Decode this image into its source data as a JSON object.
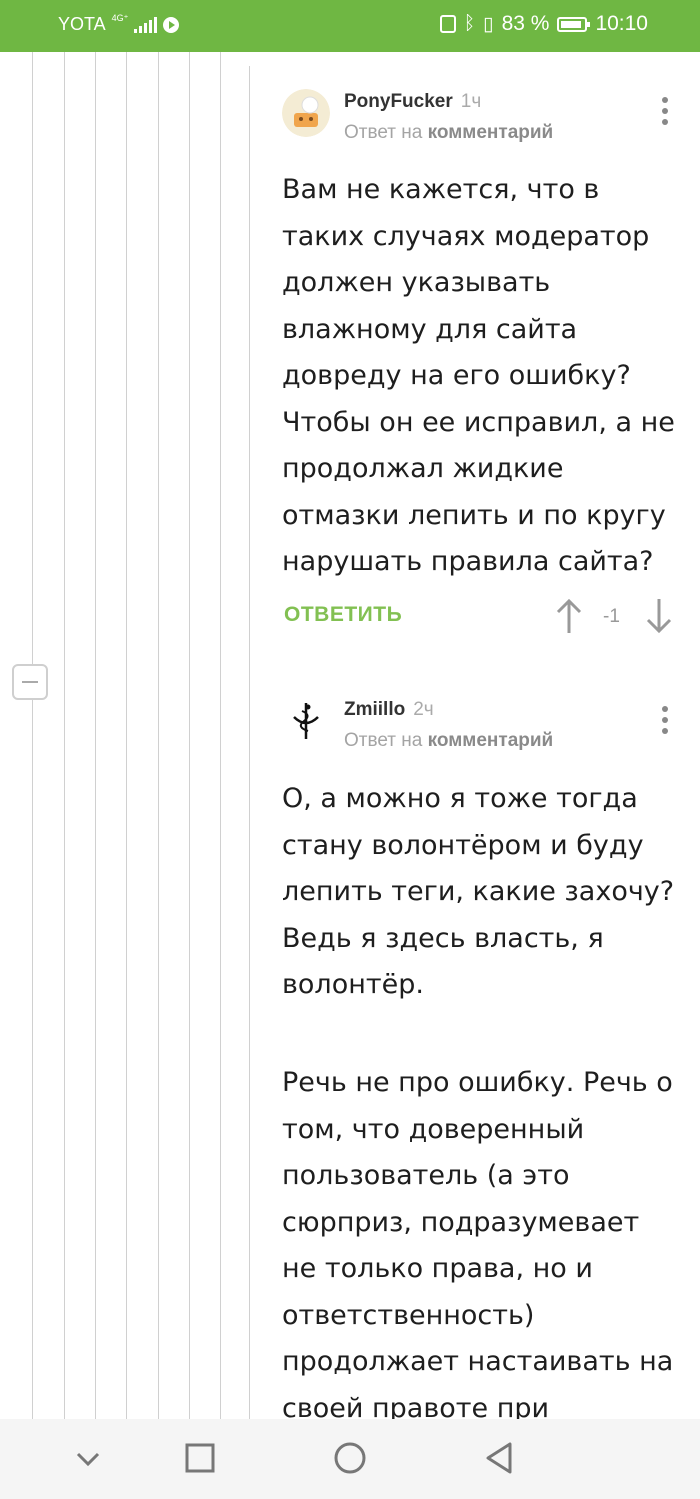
{
  "status_bar": {
    "carrier": "YOTA",
    "network": "4G⁺",
    "battery": "83 %",
    "time": "10:10",
    "icons": [
      "signal-icon",
      "media-icon",
      "nfc-icon",
      "bluetooth-icon",
      "vibrate-icon",
      "battery-icon"
    ]
  },
  "comments": [
    {
      "author": "PonyFucker",
      "time": "1ч",
      "reply_prefix": "Ответ на",
      "reply_link": "комментарий",
      "text": "Вам не кажется, что в таких случаях модератор должен указывать влажному для сайта довреду на его ошибку? Чтобы он ее исправил, а не продолжал жидкие отмазки лепить и по кругу нарушать правила сайта?",
      "reply_label": "ОТВЕТИТЬ",
      "rating": "-1"
    },
    {
      "author": "Zmiillo",
      "time": "2ч",
      "reply_prefix": "Ответ на",
      "reply_link": "комментарий",
      "text_p1": "О, а можно я тоже тогда стану волонтёром и буду лепить теги, какие захочу? Ведь я здесь власть, я волонтёр.",
      "text_p2": "Речь не про ошибку. Речь о том, что доверенный пользователь (а это сюрприз, подразумевает не только права, но и ответственность) продолжает настаивать на своей правоте при"
    }
  ],
  "colors": {
    "status_bar": "#6fb743",
    "accent_green": "#82c052",
    "muted": "#a4a4a4"
  },
  "nav": [
    "back-chevron-icon",
    "home-square-icon",
    "home-circle-icon",
    "back-triangle-icon"
  ]
}
